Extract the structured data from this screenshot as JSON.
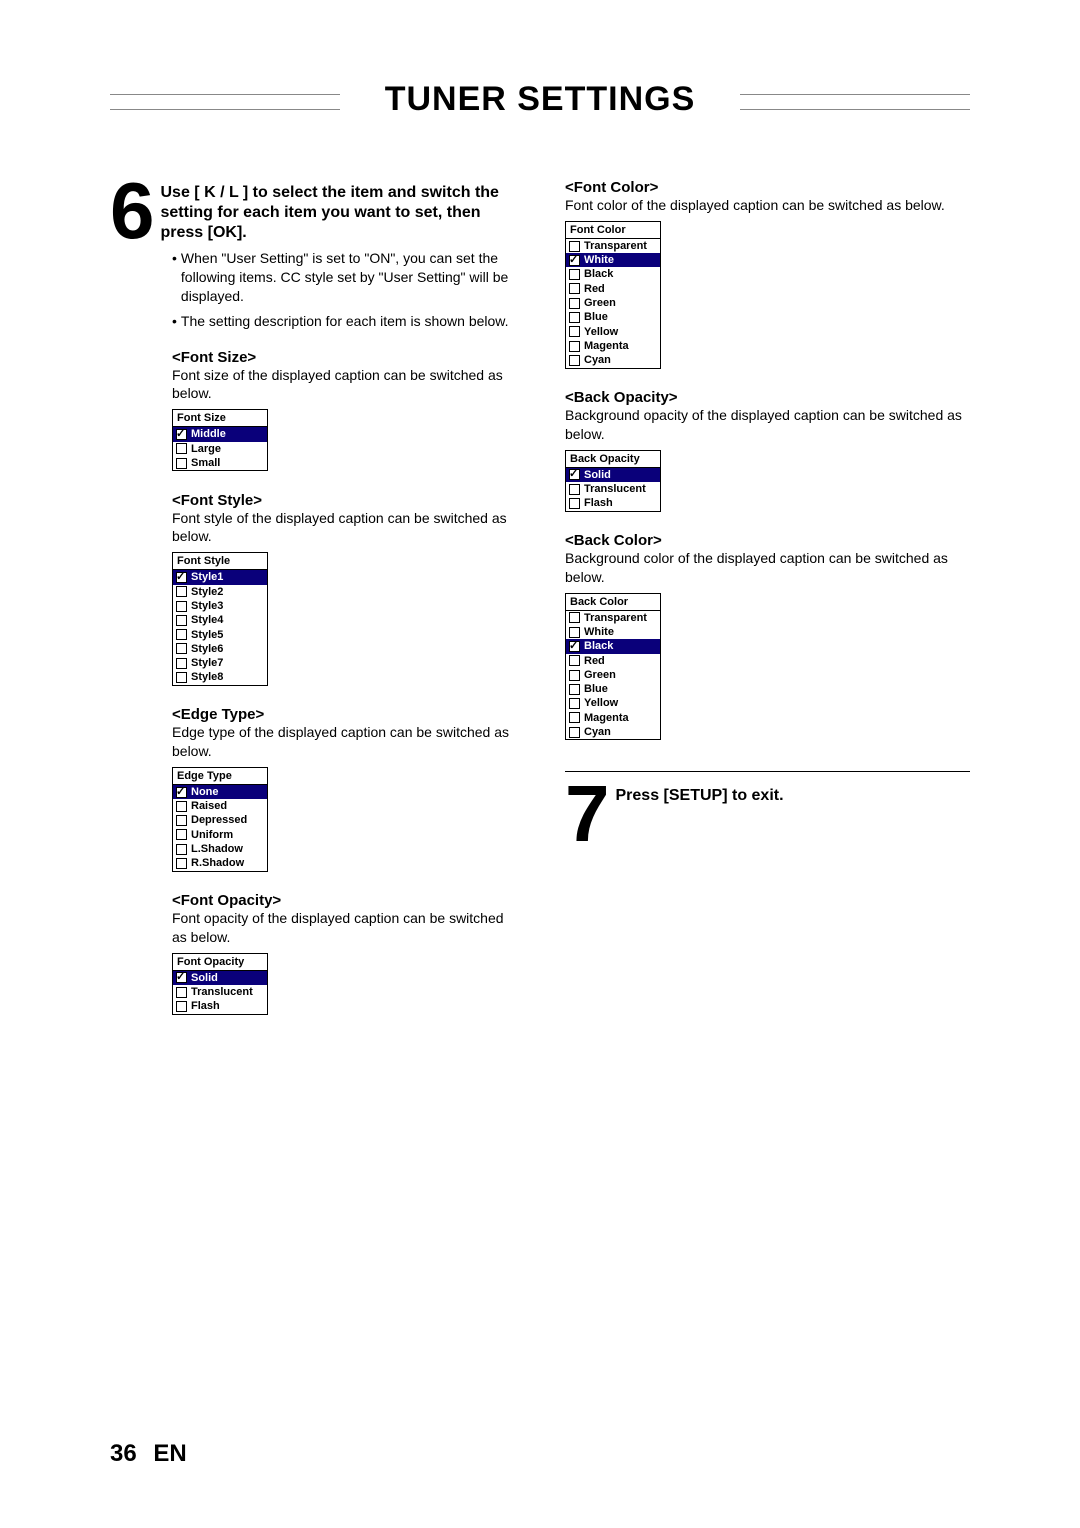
{
  "title": "TUNER SETTINGS",
  "footer": {
    "page": "36",
    "lang": "EN"
  },
  "step6": {
    "num": "6",
    "text": "Use [ K / L ] to select the item and switch the setting for each item you want to set, then press [OK].",
    "bullets": [
      "When \"User Setting\" is set to \"ON\", you can set the following items. CC style set by \"User Setting\" will be displayed.",
      "The setting description for each item is shown below."
    ]
  },
  "step7": {
    "num": "7",
    "text": "Press [SETUP] to exit."
  },
  "sections": {
    "fontSize": {
      "head": "<Font Size>",
      "desc": "Font size of the displayed caption can be switched as below.",
      "menuTitle": "Font Size",
      "items": [
        {
          "label": "Middle",
          "checked": true,
          "sel": true
        },
        {
          "label": "Large",
          "checked": false,
          "sel": false
        },
        {
          "label": "Small",
          "checked": false,
          "sel": false
        }
      ]
    },
    "fontStyle": {
      "head": "<Font Style>",
      "desc": "Font style of the displayed caption can be switched as below.",
      "menuTitle": "Font Style",
      "items": [
        {
          "label": "Style1",
          "checked": true,
          "sel": true
        },
        {
          "label": "Style2",
          "checked": false,
          "sel": false
        },
        {
          "label": "Style3",
          "checked": false,
          "sel": false
        },
        {
          "label": "Style4",
          "checked": false,
          "sel": false
        },
        {
          "label": "Style5",
          "checked": false,
          "sel": false
        },
        {
          "label": "Style6",
          "checked": false,
          "sel": false
        },
        {
          "label": "Style7",
          "checked": false,
          "sel": false
        },
        {
          "label": "Style8",
          "checked": false,
          "sel": false
        }
      ]
    },
    "edgeType": {
      "head": "<Edge Type>",
      "desc": "Edge type of the displayed caption can be switched as below.",
      "menuTitle": "Edge Type",
      "items": [
        {
          "label": "None",
          "checked": true,
          "sel": true
        },
        {
          "label": "Raised",
          "checked": false,
          "sel": false
        },
        {
          "label": "Depressed",
          "checked": false,
          "sel": false
        },
        {
          "label": "Uniform",
          "checked": false,
          "sel": false
        },
        {
          "label": "L.Shadow",
          "checked": false,
          "sel": false
        },
        {
          "label": "R.Shadow",
          "checked": false,
          "sel": false
        }
      ]
    },
    "fontOpacity": {
      "head": "<Font Opacity>",
      "desc": "Font opacity of the displayed caption can be switched as below.",
      "menuTitle": "Font Opacity",
      "items": [
        {
          "label": "Solid",
          "checked": true,
          "sel": true
        },
        {
          "label": "Translucent",
          "checked": false,
          "sel": false
        },
        {
          "label": "Flash",
          "checked": false,
          "sel": false
        }
      ]
    },
    "fontColor": {
      "head": "<Font Color>",
      "desc": "Font color of the displayed caption can be switched as below.",
      "menuTitle": "Font Color",
      "items": [
        {
          "label": "Transparent",
          "checked": false,
          "sel": false
        },
        {
          "label": "White",
          "checked": true,
          "sel": true
        },
        {
          "label": "Black",
          "checked": false,
          "sel": false
        },
        {
          "label": "Red",
          "checked": false,
          "sel": false
        },
        {
          "label": "Green",
          "checked": false,
          "sel": false
        },
        {
          "label": "Blue",
          "checked": false,
          "sel": false
        },
        {
          "label": "Yellow",
          "checked": false,
          "sel": false
        },
        {
          "label": "Magenta",
          "checked": false,
          "sel": false
        },
        {
          "label": "Cyan",
          "checked": false,
          "sel": false
        }
      ]
    },
    "backOpacity": {
      "head": "<Back Opacity>",
      "desc": "Background opacity of the displayed caption can be switched as below.",
      "menuTitle": "Back Opacity",
      "items": [
        {
          "label": "Solid",
          "checked": true,
          "sel": true
        },
        {
          "label": "Translucent",
          "checked": false,
          "sel": false
        },
        {
          "label": "Flash",
          "checked": false,
          "sel": false
        }
      ]
    },
    "backColor": {
      "head": "<Back Color>",
      "desc": "Background color of the displayed caption can be switched as below.",
      "menuTitle": "Back Color",
      "items": [
        {
          "label": "Transparent",
          "checked": false,
          "sel": false
        },
        {
          "label": "White",
          "checked": false,
          "sel": false
        },
        {
          "label": "Black",
          "checked": true,
          "sel": true
        },
        {
          "label": "Red",
          "checked": false,
          "sel": false
        },
        {
          "label": "Green",
          "checked": false,
          "sel": false
        },
        {
          "label": "Blue",
          "checked": false,
          "sel": false
        },
        {
          "label": "Yellow",
          "checked": false,
          "sel": false
        },
        {
          "label": "Magenta",
          "checked": false,
          "sel": false
        },
        {
          "label": "Cyan",
          "checked": false,
          "sel": false
        }
      ]
    }
  }
}
